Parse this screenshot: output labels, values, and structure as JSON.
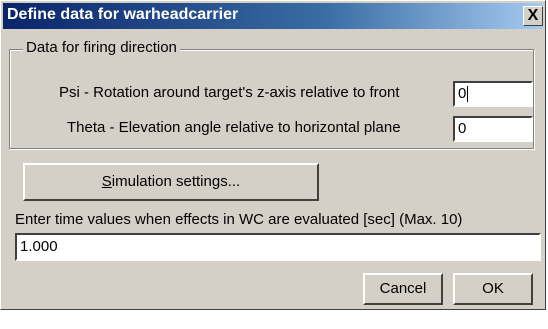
{
  "window": {
    "title": "Define data for warheadcarrier",
    "close_glyph": "X"
  },
  "firing_direction": {
    "group_label": "Data for firing direction",
    "psi_label": "Psi - Rotation around target's z-axis relative to front",
    "psi_value": "0",
    "theta_label": "Theta - Elevation angle relative to horizontal plane",
    "theta_value": "0"
  },
  "simulation_button": {
    "mnemonic": "S",
    "rest": "imulation settings..."
  },
  "time_values": {
    "label": "Enter time values when effects in WC are evaluated [sec] (Max. 10)",
    "value": "1.000"
  },
  "buttons": {
    "cancel": "Cancel",
    "ok": "OK"
  }
}
